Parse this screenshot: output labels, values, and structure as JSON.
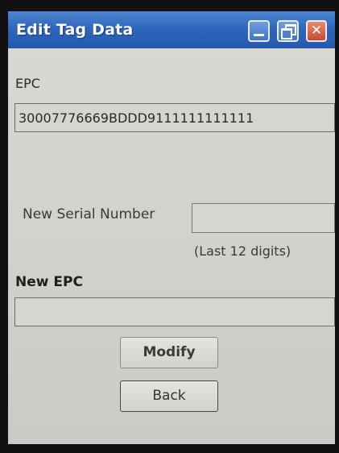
{
  "window": {
    "title": "Edit Tag Data",
    "controls": {
      "minimize_icon": "minimize-icon",
      "restore_icon": "restore-icon",
      "close_icon": "close-icon",
      "close_glyph": "✕"
    }
  },
  "form": {
    "epc_label": "EPC",
    "epc_value": "30007776669BDDD9111111111111",
    "serial_label": "New Serial Number",
    "serial_value": "",
    "serial_hint": "(Last 12 digits)",
    "new_epc_label": "New EPC",
    "new_epc_value": ""
  },
  "buttons": {
    "modify_label": "Modify",
    "back_label": "Back"
  },
  "colors": {
    "titlebar": "#2f67bd",
    "close_button": "#c9482f",
    "background": "#d3d2cc"
  }
}
